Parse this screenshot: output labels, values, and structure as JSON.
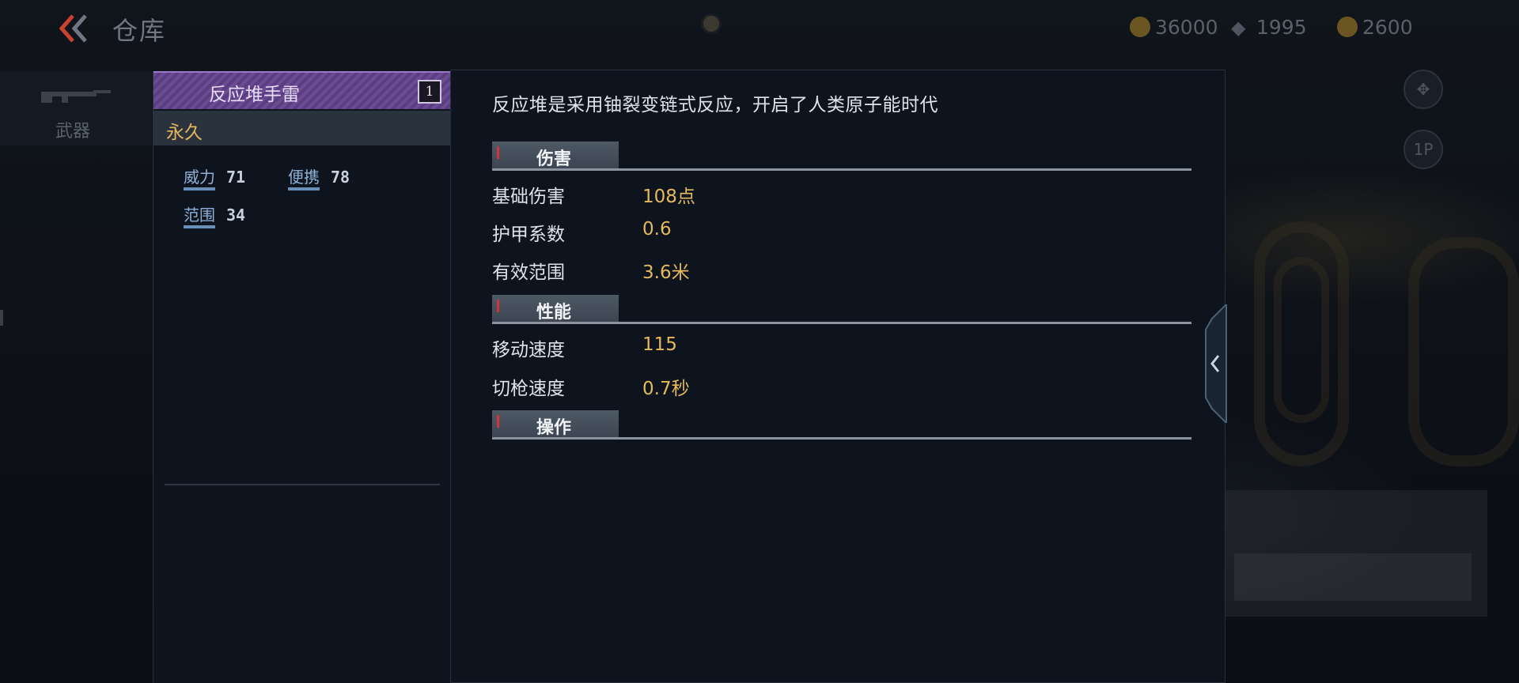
{
  "header": {
    "title": "仓库",
    "back_icon": "double-chevron-left-icon",
    "currencies": [
      {
        "icon": "gold-coin-icon",
        "value": "36000"
      },
      {
        "icon": "diamond-icon",
        "value": "1995"
      },
      {
        "icon": "medal-coin-icon",
        "value": "2600"
      }
    ],
    "side_buttons": [
      {
        "icon": "dpad-icon",
        "label": ""
      },
      {
        "icon": "player-1p-icon",
        "label": "1P"
      }
    ]
  },
  "category": {
    "label": "武器",
    "icon": "rifle-icon"
  },
  "item": {
    "name": "反应堆手雷",
    "count": "1",
    "duration": "永久",
    "attributes": [
      {
        "name": "威力",
        "value": "71"
      },
      {
        "name": "便携",
        "value": "78"
      },
      {
        "name": "范围",
        "value": "34"
      }
    ],
    "header_color": "#6b4c92"
  },
  "detail": {
    "description": "反应堆是采用铀裂变链式反应，开启了人类原子能时代",
    "sections": [
      {
        "title": "伤害",
        "stats": [
          {
            "name": "基础伤害",
            "value": "108点"
          },
          {
            "name": "护甲系数",
            "value": "0.6"
          },
          {
            "name": "有效范围",
            "value": "3.6米"
          }
        ]
      },
      {
        "title": "性能",
        "stats": [
          {
            "name": "移动速度",
            "value": "115"
          },
          {
            "name": "切枪速度",
            "value": "0.7秒"
          }
        ]
      },
      {
        "title": "操作",
        "stats": []
      }
    ],
    "value_color": "#e6b95c"
  },
  "collapse_icon": "chevron-left-icon"
}
